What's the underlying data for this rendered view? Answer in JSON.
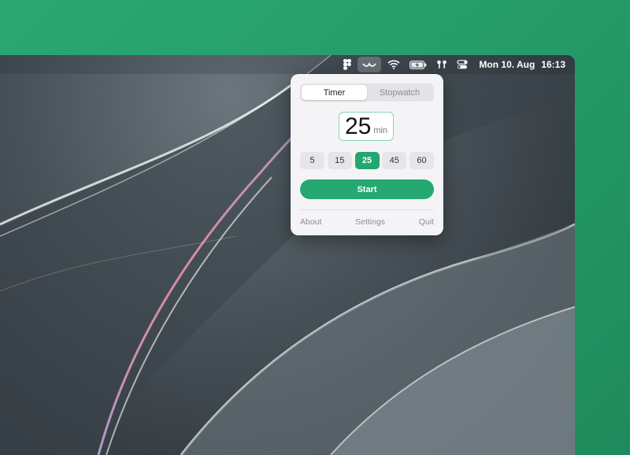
{
  "menubar": {
    "icons": [
      "figma-icon",
      "tomato-timer-icon",
      "wifi-icon",
      "battery-charging-icon",
      "airpods-icon",
      "control-center-icon"
    ],
    "date": "Mon 10. Aug",
    "time": "16:13"
  },
  "popover": {
    "tabs": [
      "Timer",
      "Stopwatch"
    ],
    "active_tab": "Timer",
    "duration_value": "25",
    "duration_unit": "min",
    "presets": [
      "5",
      "15",
      "25",
      "45",
      "60"
    ],
    "selected_preset": "25",
    "start_label": "Start",
    "footer": {
      "about": "About",
      "settings": "Settings",
      "quit": "Quit"
    }
  },
  "colors": {
    "accent": "#26a872",
    "background": "#2aa873",
    "popover_bg": "#f4f4f6"
  }
}
